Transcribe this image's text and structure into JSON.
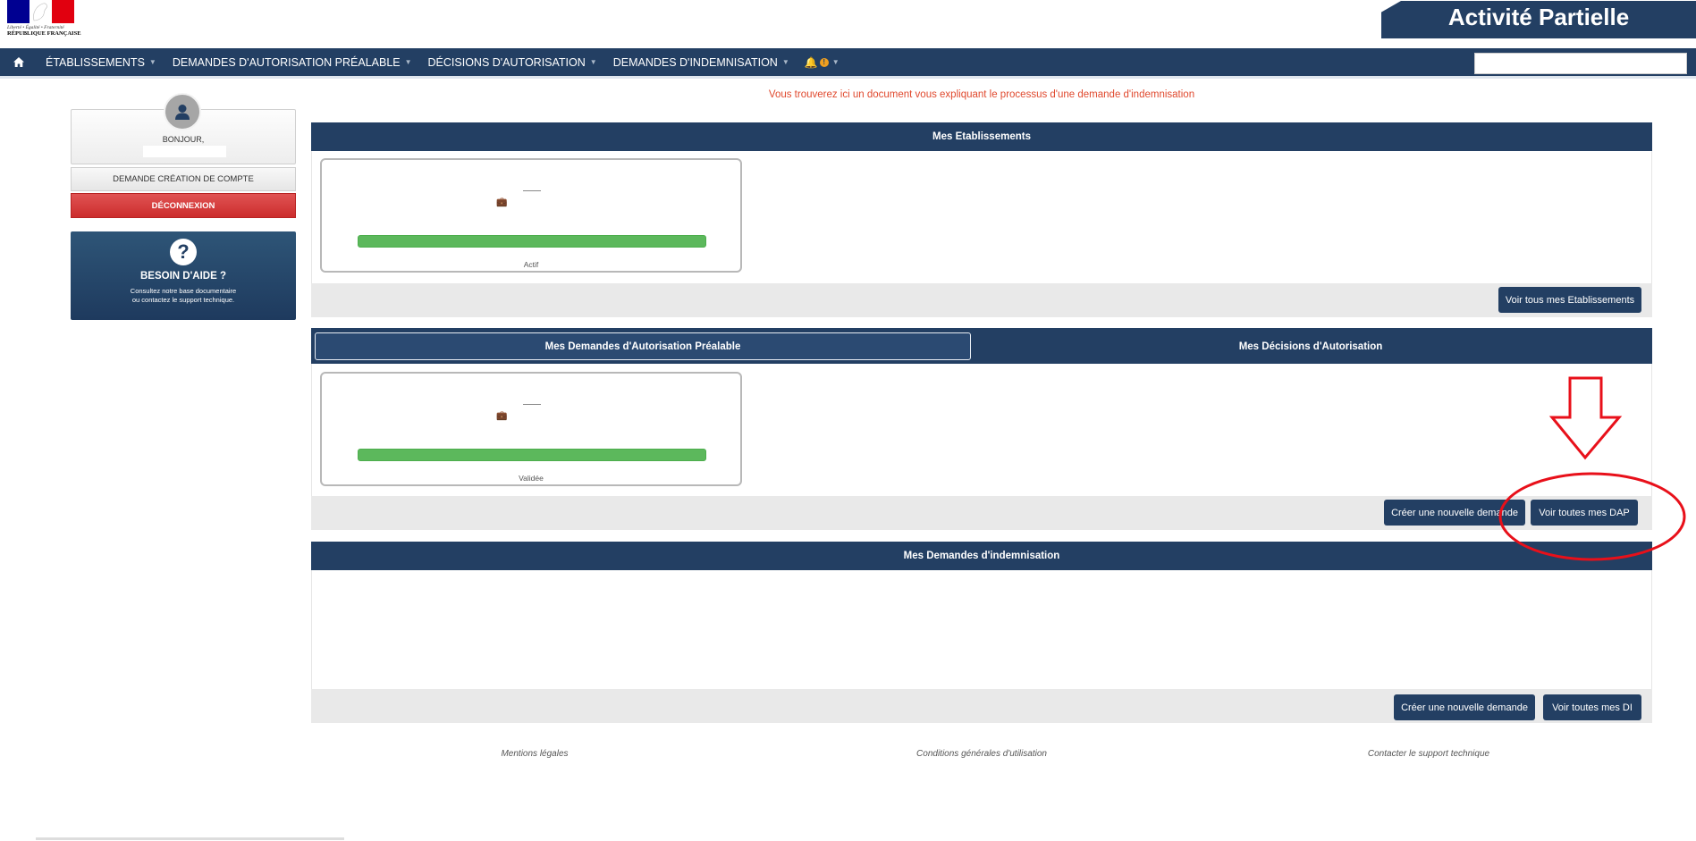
{
  "header": {
    "logo_motto": "Liberté • Égalité • Fraternité",
    "logo_republic": "RÉPUBLIQUE FRANÇAISE",
    "app_title": "Activité Partielle",
    "colors": {
      "navy": "#233f63",
      "red": "#e1000f",
      "blue": "#000091"
    }
  },
  "nav": {
    "home_icon": "home-icon",
    "items": [
      {
        "label": "ÉTABLISSEMENTS"
      },
      {
        "label": "DEMANDES D'AUTORISATION PRÉALABLE"
      },
      {
        "label": "DÉCISIONS D'AUTORISATION"
      },
      {
        "label": "DEMANDES D'INDEMNISATION"
      }
    ],
    "notifications_icon": "bell-icon",
    "notifications_badge": "!",
    "search": {
      "value": "",
      "placeholder": ""
    }
  },
  "sidebar": {
    "greeting": "BONJOUR,",
    "create_account_label": "DEMANDE CRÉATION DE COMPTE",
    "logout_label": "DÉCONNEXION",
    "help": {
      "icon": "question-icon",
      "title": "BESOIN D'AIDE ?",
      "line1": "Consultez notre base documentaire",
      "line2": "ou contactez le support technique."
    }
  },
  "main": {
    "info_link": "Vous trouverez ici un document vous expliquant le processus d'une demande d'indemnisation",
    "establishments": {
      "title": "Mes Etablissements",
      "card_status": "Actif",
      "card_progress": 1.0,
      "view_all_label": "Voir tous mes Etablissements"
    },
    "authorizations": {
      "tab_active": "Mes Demandes d'Autorisation Préalable",
      "tab_inactive": "Mes Décisions d'Autorisation",
      "card_status": "Validée",
      "card_progress": 1.0,
      "create_label": "Créer une nouvelle demande",
      "view_all_label": "Voir toutes mes DAP"
    },
    "indemnities": {
      "title": "Mes Demandes d'indemnisation",
      "create_label": "Créer une nouvelle demande",
      "view_all_label": "Voir toutes mes DI"
    }
  },
  "footer": {
    "legal": "Mentions légales",
    "terms": "Conditions générales d'utilisation",
    "support": "Contacter le support technique"
  },
  "annotation": {
    "color": "#e8101a",
    "shapes": [
      "down-arrow",
      "ellipse"
    ]
  }
}
